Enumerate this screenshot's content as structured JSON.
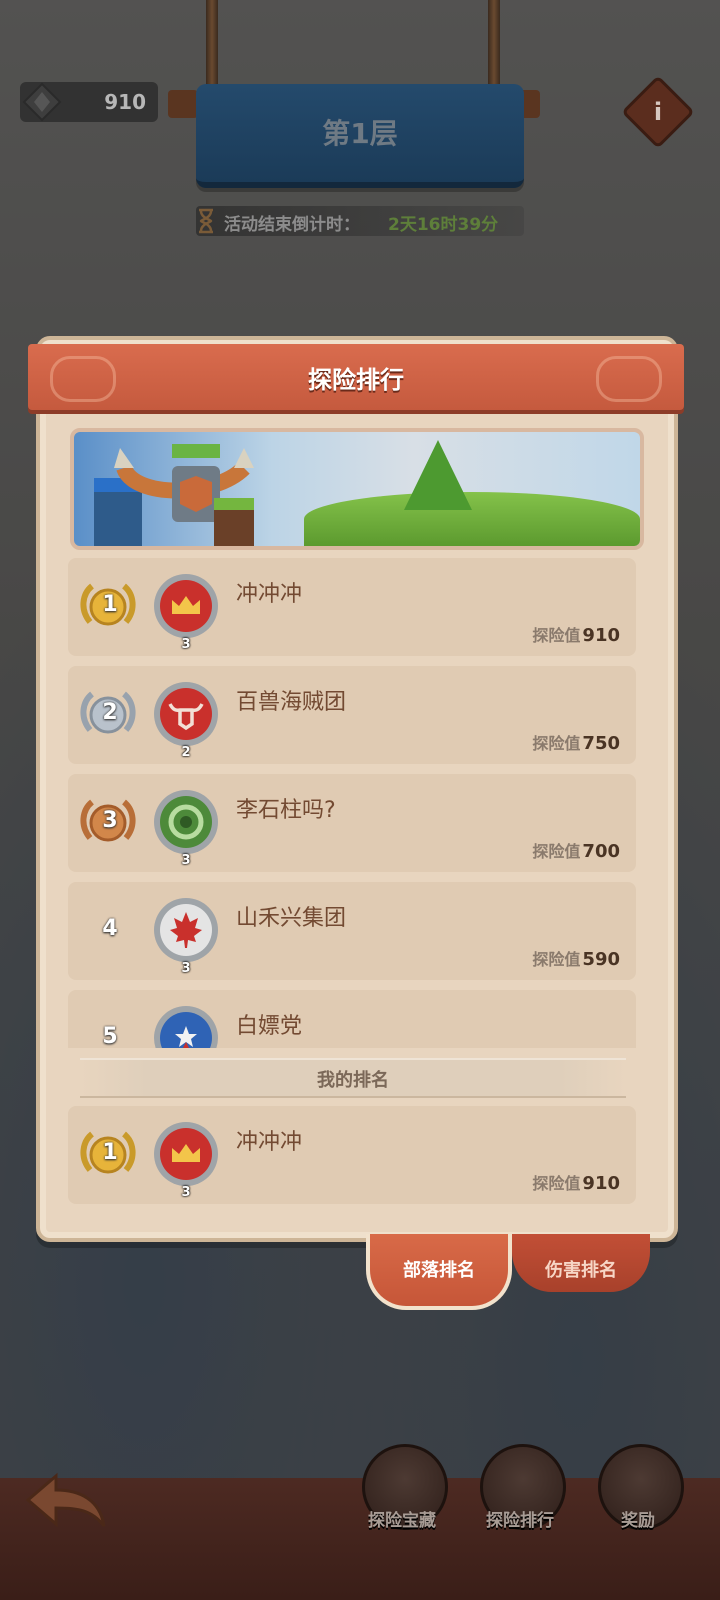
{
  "hud": {
    "resource_value": "910",
    "info_label": "i",
    "floor_title": "第1层",
    "countdown_label": "活动结束倒计时：",
    "countdown_time": "2天16时39分"
  },
  "panel": {
    "title": "探险排行",
    "score_label": "探险值",
    "my_rank_label": "我的排名"
  },
  "rankings": [
    {
      "rank": "1",
      "name": "冲冲冲",
      "score": "910",
      "level": "3",
      "emblem": "crown-emblem-icon",
      "emblem_color": "#c9302c"
    },
    {
      "rank": "2",
      "name": "百兽海贼团",
      "score": "750",
      "level": "2",
      "emblem": "bull-emblem-icon",
      "emblem_color": "#c9302c"
    },
    {
      "rank": "3",
      "name": "李石柱吗?",
      "score": "700",
      "level": "3",
      "emblem": "serpent-emblem-icon",
      "emblem_color": "#4d8a3a"
    },
    {
      "rank": "4",
      "name": "山禾兴集团",
      "score": "590",
      "level": "3",
      "emblem": "maple-leaf-emblem-icon",
      "emblem_color": "#e4e4e4"
    },
    {
      "rank": "5",
      "name": "白嫖党",
      "score": "",
      "level": "",
      "emblem": "star-emblem-icon",
      "emblem_color": "#2f63b5"
    }
  ],
  "my_rank": {
    "rank": "1",
    "name": "冲冲冲",
    "score": "910",
    "level": "3",
    "emblem": "crown-emblem-icon"
  },
  "tabs": [
    {
      "label": "部落排名",
      "active": true
    },
    {
      "label": "伤害排名",
      "active": false
    }
  ],
  "bottom_nav": [
    {
      "label": "探险宝藏",
      "icon": "treasure-chest-icon"
    },
    {
      "label": "探险排行",
      "icon": "podium-icon"
    },
    {
      "label": "奖励",
      "icon": "medal-icon"
    }
  ],
  "colors": {
    "panel_bg": "#e8d5bf",
    "ribbon": "#d96c4e",
    "row_bg": "#e0cbb3",
    "name_text": "#734a32",
    "gold": "#e7b43a",
    "silver": "#b9c2cc",
    "bronze": "#d2874a"
  }
}
